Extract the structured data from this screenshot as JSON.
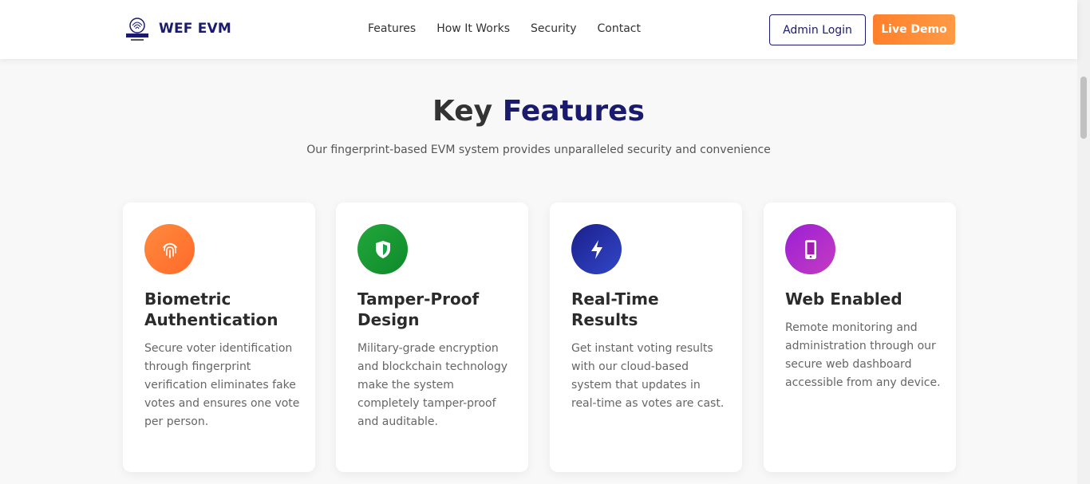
{
  "navbar": {
    "brand": "WEF EVM",
    "links": [
      "Features",
      "How It Works",
      "Security",
      "Contact"
    ],
    "admin_login": "Admin Login",
    "live_demo": "Live Demo"
  },
  "section": {
    "title_prefix": "Key",
    "title_accent": "Features",
    "subtitle": "Our fingerprint-based EVM system provides unparalleled security and convenience"
  },
  "cards": [
    {
      "title": "Biometric Authentication",
      "text": "Secure voter identification through fingerprint verification eliminates fake votes and ensures one vote per person.",
      "icon": "fingerprint-icon",
      "color": "#ff7f2a"
    },
    {
      "title": "Tamper-Proof Design",
      "text": "Military-grade encryption and blockchain technology make the system completely tamper-proof and auditable.",
      "icon": "shield-icon",
      "color": "#16a34a"
    },
    {
      "title": "Real-Time Results",
      "text": "Get instant voting results with our cloud-based system that updates in real-time as votes are cast.",
      "icon": "bolt-icon",
      "color": "#1e2a9c"
    },
    {
      "title": "Web Enabled",
      "text": "Remote monitoring and administration through our secure web dashboard accessible from any device.",
      "icon": "mobile-icon",
      "color": "#a21caf"
    }
  ]
}
